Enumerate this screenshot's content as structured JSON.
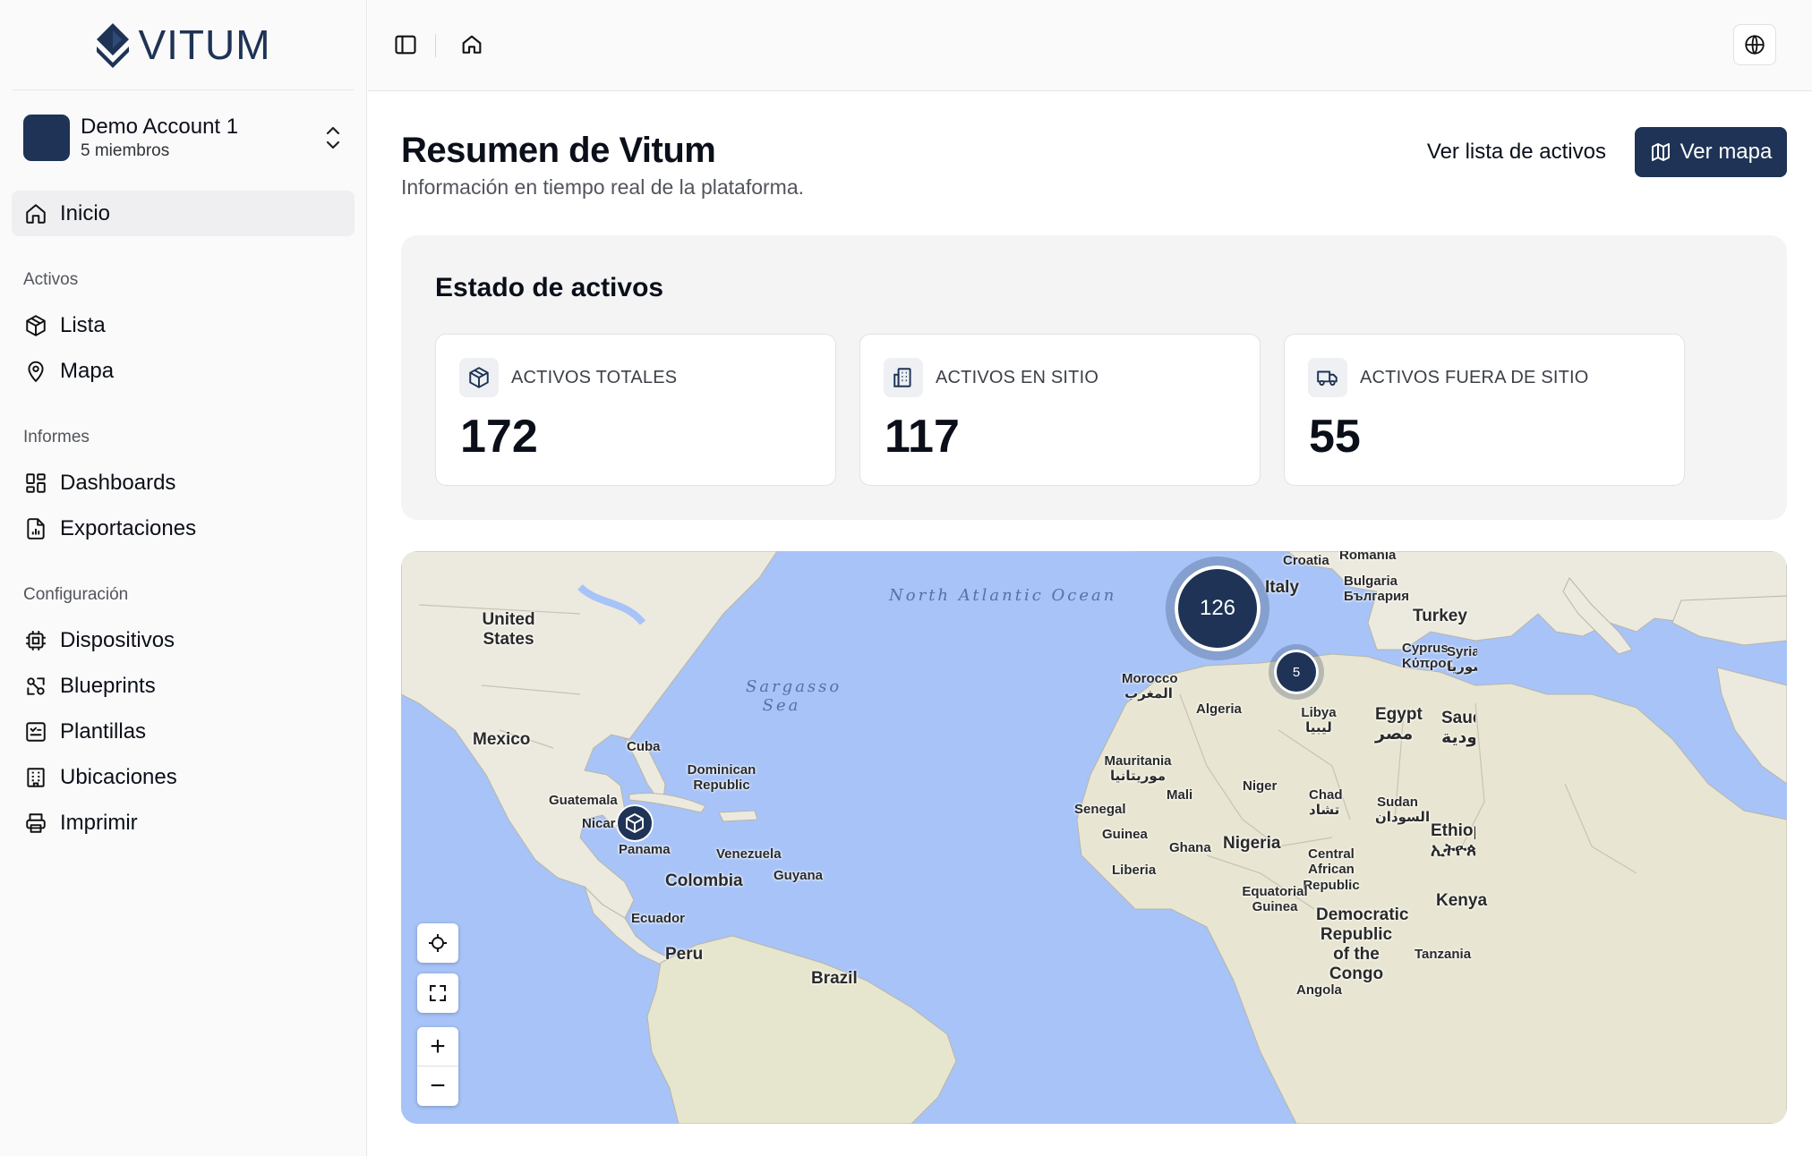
{
  "brand": {
    "name": "VITUM"
  },
  "account": {
    "name": "Demo Account 1",
    "members": "5 miembros"
  },
  "nav": {
    "home": "Inicio",
    "sections": [
      {
        "title": "Activos",
        "items": [
          "Lista",
          "Mapa"
        ]
      },
      {
        "title": "Informes",
        "items": [
          "Dashboards",
          "Exportaciones"
        ]
      },
      {
        "title": "Configuración",
        "items": [
          "Dispositivos",
          "Blueprints",
          "Plantillas",
          "Ubicaciones",
          "Imprimir"
        ]
      }
    ]
  },
  "page": {
    "title": "Resumen de Vitum",
    "subtitle": "Información en tiempo real de la plataforma.",
    "link_label": "Ver lista de activos",
    "primary_label": "Ver mapa"
  },
  "status": {
    "title": "Estado de activos",
    "cards": [
      {
        "label": "ACTIVOS TOTALES",
        "value": "172",
        "icon": "box-icon"
      },
      {
        "label": "ACTIVOS EN SITIO",
        "value": "117",
        "icon": "building-icon"
      },
      {
        "label": "ACTIVOS FUERA DE SITIO",
        "value": "55",
        "icon": "truck-icon"
      }
    ]
  },
  "map": {
    "clusters": [
      {
        "count": "126"
      },
      {
        "count": "5"
      }
    ],
    "oceans": [
      "North Atlantic Ocean",
      "Sargasso Sea"
    ],
    "labels": {
      "us": "United States",
      "mexico": "Mexico",
      "cuba": "Cuba",
      "dominican": "Dominican Republic",
      "guatemala": "Guatemala",
      "nicaragua": "Nicaragua",
      "panama": "Panama",
      "venezuela": "Venezuela",
      "guyana": "Guyana",
      "colombia": "Colombia",
      "ecuador": "Ecuador",
      "peru": "Peru",
      "brazil": "Brazil",
      "croatia": "Croatia",
      "romania": "Romania",
      "italy": "Italy",
      "bulgaria": "Bulgaria България",
      "turkey": "Turkey",
      "cyprus": "Cyprus Κύπρος",
      "syria": "Syria سوريا",
      "morocco": "Morocco المغرب",
      "algeria": "Algeria",
      "libya": "Libya ليبيا",
      "egypt": "Egypt مصر",
      "saudi": "Saudi السعودية",
      "mauritania": "Mauritania موريتانيا",
      "mali": "Mali",
      "niger": "Niger",
      "chad": "Chad تشاد",
      "sudan": "Sudan السودان",
      "senegal": "Senegal",
      "guinea": "Guinea",
      "ghana": "Ghana",
      "nigeria": "Nigeria",
      "ethiopia": "Ethiopia ኢትዮጵያ",
      "car": "Central African Republic",
      "liberia": "Liberia",
      "eqguinea": "Equatorial Guinea",
      "drc": "Democratic Republic of the Congo",
      "kenya": "Kenya",
      "tanzania": "Tanzania",
      "angola": "Angola"
    }
  }
}
